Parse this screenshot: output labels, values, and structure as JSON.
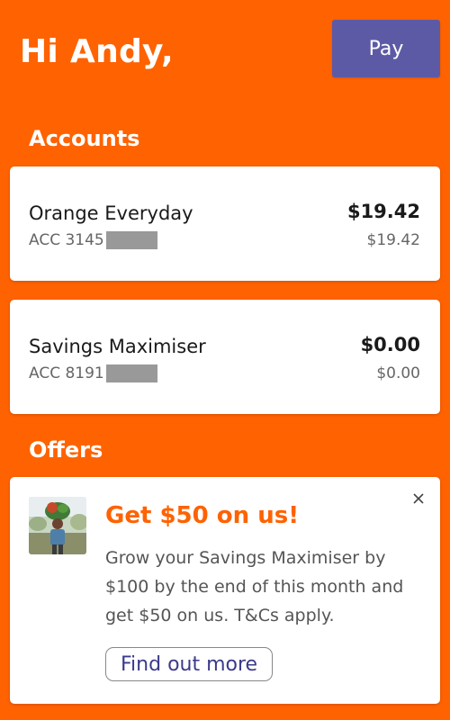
{
  "header": {
    "greeting": "Hi Andy,",
    "pay_label": "Pay"
  },
  "accounts": {
    "title": "Accounts",
    "items": [
      {
        "name": "Orange Everyday",
        "number_prefix": "ACC 3145",
        "balance": "$19.42",
        "available": "$19.42"
      },
      {
        "name": "Savings Maximiser",
        "number_prefix": "ACC 8191",
        "balance": "$0.00",
        "available": "$0.00"
      }
    ]
  },
  "offers": {
    "title": "Offers",
    "card": {
      "headline": "Get $50 on us!",
      "body": "Grow your Savings Maximiser by $100 by the end of this month and get $50 on us. T&Cs apply.",
      "cta_label": "Find out more",
      "close_icon": "close-icon",
      "image_icon": "offer-photo"
    }
  },
  "colors": {
    "brand_orange": "#ff6200",
    "pay_button": "#5d5aa5",
    "cta_text": "#3b3a8a"
  }
}
